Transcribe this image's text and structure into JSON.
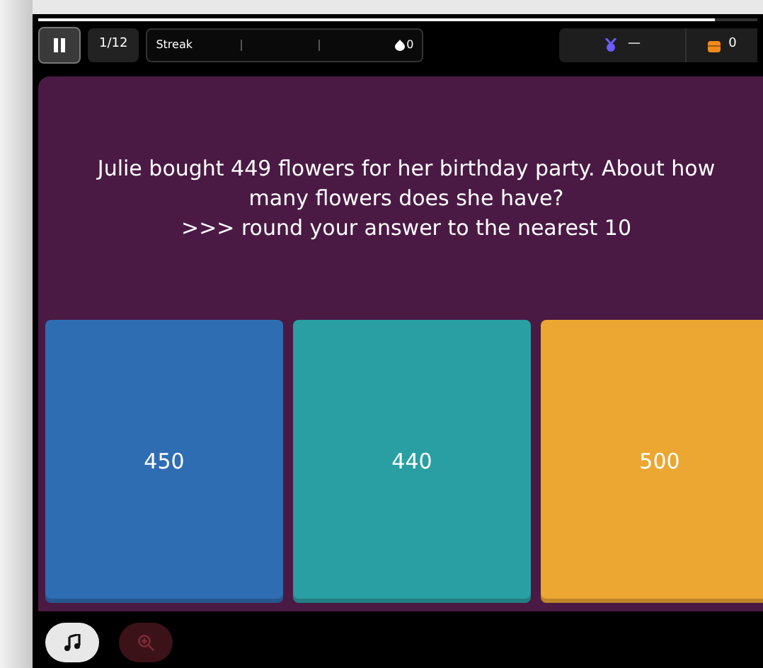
{
  "timer": {
    "level": 0.94
  },
  "top_bar": {
    "progress": "1/12",
    "streak": {
      "label": "Streak",
      "value": "0"
    },
    "medal": "—",
    "coins": "0"
  },
  "question": {
    "lines": [
      "Julie bought 449 flowers for her birthday party. About how many flowers does she have?",
      ">>> round your answer to the nearest 10"
    ]
  },
  "answers": [
    {
      "text": "450",
      "color": "#2f6db3"
    },
    {
      "text": "440",
      "color": "#2a9fa3"
    },
    {
      "text": "500",
      "color": "#eba731"
    }
  ],
  "bottom_buttons": [
    {
      "kind": "music",
      "disabled": false
    },
    {
      "kind": "zoom",
      "disabled": true
    }
  ]
}
